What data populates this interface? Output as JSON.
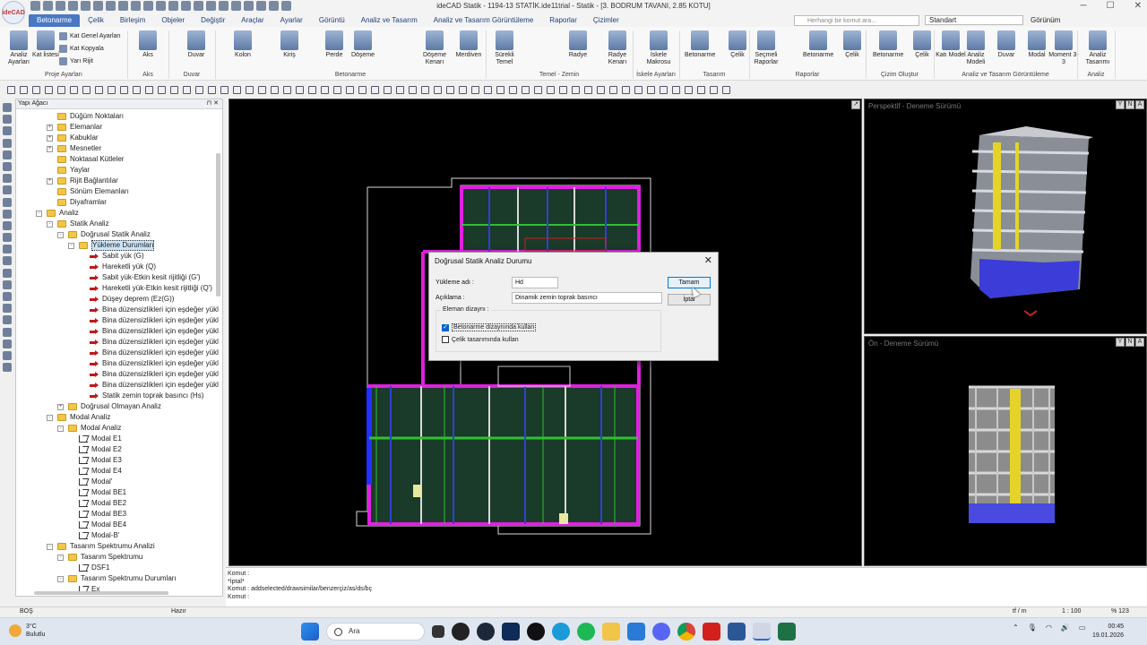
{
  "app": {
    "logo": "ideCAD",
    "title": "ideCAD Statik - 1194-13 STATİK.ide11trial - Statik - [3. BODRUM TAVANI,  2.85 KOTU]"
  },
  "menu": [
    "Betonarme",
    "Çelik",
    "Birleşim",
    "Objeler",
    "Değiştir",
    "Araçlar",
    "Ayarlar",
    "Görüntü",
    "Analiz ve Tasarım",
    "Analiz ve Tasarım Görüntüleme",
    "Raporlar",
    "Çizimler"
  ],
  "command_search_placeholder": "Herhangi bir komut ara...",
  "style_select": "Standart",
  "view_menu": "Görünüm",
  "ribbon": {
    "buttons": [
      {
        "label": "Analiz Ayarları"
      },
      {
        "label": "Kat listesi"
      },
      {
        "label": "Aks"
      },
      {
        "label": "Duvar"
      },
      {
        "label": "Kolon"
      },
      {
        "label": "Kiriş"
      },
      {
        "label": "Perde"
      },
      {
        "label": "Döşeme"
      },
      {
        "label": "Döşeme Kenarı"
      },
      {
        "label": "Merdiven"
      },
      {
        "label": "Sürekli Temel"
      },
      {
        "label": "Radye"
      },
      {
        "label": "Radye Kenarı"
      },
      {
        "label": "İskele Makrosu"
      },
      {
        "label": "Betonarme"
      },
      {
        "label": "Çelik"
      },
      {
        "label": "Seçmeli Raporlar"
      },
      {
        "label": "Betonarme"
      },
      {
        "label": "Çelik"
      },
      {
        "label": "Betonarme"
      },
      {
        "label": "Çelik"
      },
      {
        "label": "Katı Model"
      },
      {
        "label": "Analiz Modeli"
      },
      {
        "label": "Duvar"
      },
      {
        "label": "Modal"
      },
      {
        "label": "Moment 3-3"
      },
      {
        "label": "Analiz Tasarımı"
      }
    ],
    "small": [
      "Kat Genel Ayarları",
      "Kat Kopyala",
      "Yarı Rijit"
    ],
    "groups": [
      "Proje Ayarları",
      "Aks",
      "Duvar",
      "Betonarme",
      "Temel - Zemin",
      "İskele Ayarları",
      "Tasarım",
      "Raporlar",
      "Çizim Oluştur",
      "Analiz ve Tasarım Görüntüleme",
      "Analiz"
    ]
  },
  "tree": {
    "title": "Yapı Ağacı",
    "items": [
      {
        "label": "Düğüm Noktaları",
        "icon": "folder",
        "level": 1,
        "exp": ""
      },
      {
        "label": "Elemanlar",
        "icon": "folder",
        "level": 1,
        "exp": "+"
      },
      {
        "label": "Kabuklar",
        "icon": "folder",
        "level": 1,
        "exp": "+"
      },
      {
        "label": "Mesnetler",
        "icon": "folder",
        "level": 1,
        "exp": "+"
      },
      {
        "label": "Noktasal Kütleler",
        "icon": "folder",
        "level": 1,
        "exp": ""
      },
      {
        "label": "Yaylar",
        "icon": "folder",
        "level": 1,
        "exp": ""
      },
      {
        "label": "Rijit Bağlantılar",
        "icon": "folder",
        "level": 1,
        "exp": "+"
      },
      {
        "label": "Sönüm Elemanları",
        "icon": "folder",
        "level": 1,
        "exp": ""
      },
      {
        "label": "Diyaframlar",
        "icon": "folder",
        "level": 1,
        "exp": ""
      },
      {
        "label": "Analiz",
        "icon": "folder",
        "level": 0,
        "exp": "-"
      },
      {
        "label": "Statik Analiz",
        "icon": "folder",
        "level": 1,
        "exp": "-"
      },
      {
        "label": "Doğrusal Statik Analiz",
        "icon": "folder",
        "level": 2,
        "exp": "-"
      },
      {
        "label": "Yükleme Durumları",
        "icon": "folder",
        "level": 3,
        "exp": "-",
        "selected": true
      },
      {
        "label": "Sabit yük (G)",
        "icon": "arrow",
        "level": 4,
        "exp": ""
      },
      {
        "label": "Hareketli yük (Q)",
        "icon": "arrow",
        "level": 4,
        "exp": ""
      },
      {
        "label": "Sabit yük-Etkin kesit rijitliği (G')",
        "icon": "arrow",
        "level": 4,
        "exp": ""
      },
      {
        "label": "Hareketli yük-Etkin kesit rijitliği (Q')",
        "icon": "arrow",
        "level": 4,
        "exp": ""
      },
      {
        "label": "Düşey deprem (Ez(G))",
        "icon": "arrow",
        "level": 4,
        "exp": ""
      },
      {
        "label": "Bina düzensizlikleri için eşdeğer yükl",
        "icon": "arrow",
        "level": 4,
        "exp": ""
      },
      {
        "label": "Bina düzensizlikleri için eşdeğer yükl",
        "icon": "arrow",
        "level": 4,
        "exp": ""
      },
      {
        "label": "Bina düzensizlikleri için eşdeğer yükl",
        "icon": "arrow",
        "level": 4,
        "exp": ""
      },
      {
        "label": "Bina düzensizlikleri için eşdeğer yükl",
        "icon": "arrow",
        "level": 4,
        "exp": ""
      },
      {
        "label": "Bina düzensizlikleri için eşdeğer yükl",
        "icon": "arrow",
        "level": 4,
        "exp": ""
      },
      {
        "label": "Bina düzensizlikleri için eşdeğer yükl",
        "icon": "arrow",
        "level": 4,
        "exp": ""
      },
      {
        "label": "Bina düzensizlikleri için eşdeğer yükl",
        "icon": "arrow",
        "level": 4,
        "exp": ""
      },
      {
        "label": "Bina düzensizlikleri için eşdeğer yükl",
        "icon": "arrow",
        "level": 4,
        "exp": ""
      },
      {
        "label": "Statik zemin toprak basıncı (Hs)",
        "icon": "arrow",
        "level": 4,
        "exp": ""
      },
      {
        "label": "Doğrusal Olmayan Analiz",
        "icon": "folder",
        "level": 2,
        "exp": "+"
      },
      {
        "label": "Modal Analiz",
        "icon": "folder",
        "level": 1,
        "exp": "-"
      },
      {
        "label": "Modal Analiz",
        "icon": "folder",
        "level": 2,
        "exp": "-"
      },
      {
        "label": "Modal E1",
        "icon": "mode",
        "level": 3,
        "exp": ""
      },
      {
        "label": "Modal E2",
        "icon": "mode",
        "level": 3,
        "exp": ""
      },
      {
        "label": "Modal E3",
        "icon": "mode",
        "level": 3,
        "exp": ""
      },
      {
        "label": "Modal E4",
        "icon": "mode",
        "level": 3,
        "exp": ""
      },
      {
        "label": "Modal'",
        "icon": "mode",
        "level": 3,
        "exp": ""
      },
      {
        "label": "Modal BE1",
        "icon": "mode",
        "level": 3,
        "exp": ""
      },
      {
        "label": "Modal BE2",
        "icon": "mode",
        "level": 3,
        "exp": ""
      },
      {
        "label": "Modal BE3",
        "icon": "mode",
        "level": 3,
        "exp": ""
      },
      {
        "label": "Modal BE4",
        "icon": "mode",
        "level": 3,
        "exp": ""
      },
      {
        "label": "Modal-B'",
        "icon": "mode",
        "level": 3,
        "exp": ""
      },
      {
        "label": "Tasarım Spektrumu Analizi",
        "icon": "folder",
        "level": 1,
        "exp": "-"
      },
      {
        "label": "Tasarım Spektrumu",
        "icon": "folder",
        "level": 2,
        "exp": "-"
      },
      {
        "label": "DSF1",
        "icon": "mode",
        "level": 3,
        "exp": ""
      },
      {
        "label": "Tasarım Spektrumu Durumları",
        "icon": "folder",
        "level": 2,
        "exp": "-"
      },
      {
        "label": "Ex",
        "icon": "mode",
        "level": 3,
        "exp": ""
      }
    ]
  },
  "viewports": {
    "perspective_label": "Perspektif - Deneme Sürümü",
    "front_label": "Ön - Deneme Sürümü"
  },
  "command_lines": [
    "Komut :",
    "*İptal*",
    "Komut : addselected/drawsimilar/benzerçiz/as/ds/bç",
    "Komut :"
  ],
  "status": {
    "left": "BOŞ",
    "mid": "Hazır",
    "units": "tf / m",
    "scale": "1 : 100",
    "zoom": "% 123"
  },
  "taskbar": {
    "temp": "3°C",
    "weather": "Bulutlu",
    "search": "Ara",
    "time": "00:45",
    "date": "19.01.2026"
  },
  "dialog": {
    "title": "Doğrusal Statik Analiz Durumu",
    "load_name_label": "Yükleme adı :",
    "load_name_value": "Hd",
    "desc_label": "Açıklama :",
    "desc_value": "Dinamik zemin toprak basıncı",
    "group_label": "Eleman dizaynı :",
    "chk1": "Betonarme dizaynında kullan",
    "chk2": "Çelik tasarımında kullan",
    "ok": "Tamam",
    "cancel": "İptal"
  }
}
